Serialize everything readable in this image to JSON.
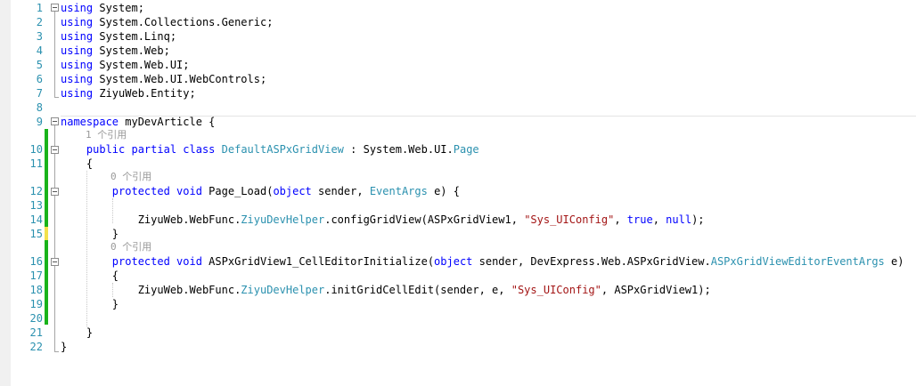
{
  "editor": {
    "line_numbers": [
      "1",
      "2",
      "3",
      "4",
      "5",
      "6",
      "7",
      "8",
      "9",
      "10",
      "11",
      "12",
      "13",
      "14",
      "15",
      "16",
      "17",
      "18",
      "19",
      "20",
      "21",
      "22"
    ],
    "lines": {
      "l1": [
        {
          "k": "kw",
          "t": "using"
        },
        {
          "k": "plain",
          "t": " System;"
        }
      ],
      "l2": [
        {
          "k": "kw",
          "t": "using"
        },
        {
          "k": "plain",
          "t": " System.Collections.Generic;"
        }
      ],
      "l3": [
        {
          "k": "kw",
          "t": "using"
        },
        {
          "k": "plain",
          "t": " System.Linq;"
        }
      ],
      "l4": [
        {
          "k": "kw",
          "t": "using"
        },
        {
          "k": "plain",
          "t": " System.Web;"
        }
      ],
      "l5": [
        {
          "k": "kw",
          "t": "using"
        },
        {
          "k": "plain",
          "t": " System.Web.UI;"
        }
      ],
      "l6": [
        {
          "k": "kw",
          "t": "using"
        },
        {
          "k": "plain",
          "t": " System.Web.UI.WebControls;"
        }
      ],
      "l7": [
        {
          "k": "kw",
          "t": "using"
        },
        {
          "k": "plain",
          "t": " ZiyuWeb.Entity;"
        }
      ],
      "l8": [],
      "l9": [
        {
          "k": "kw",
          "t": "namespace"
        },
        {
          "k": "plain",
          "t": " myDevArticle {"
        }
      ],
      "l10": [
        {
          "k": "plain",
          "t": "    "
        },
        {
          "k": "kw",
          "t": "public partial class"
        },
        {
          "k": "plain",
          "t": " "
        },
        {
          "k": "type",
          "t": "DefaultASPxGridView"
        },
        {
          "k": "plain",
          "t": " : System.Web.UI."
        },
        {
          "k": "type",
          "t": "Page"
        }
      ],
      "l11": [
        {
          "k": "plain",
          "t": "    {"
        }
      ],
      "l12": [
        {
          "k": "plain",
          "t": "        "
        },
        {
          "k": "kw",
          "t": "protected void"
        },
        {
          "k": "plain",
          "t": " Page_Load("
        },
        {
          "k": "kw",
          "t": "object"
        },
        {
          "k": "plain",
          "t": " sender, "
        },
        {
          "k": "type",
          "t": "EventArgs"
        },
        {
          "k": "plain",
          "t": " e) {"
        }
      ],
      "l13": [],
      "l14": [
        {
          "k": "plain",
          "t": "            ZiyuWeb.WebFunc."
        },
        {
          "k": "type",
          "t": "ZiyuDevHelper"
        },
        {
          "k": "plain",
          "t": ".configGridView(ASPxGridView1, "
        },
        {
          "k": "str",
          "t": "\"Sys_UIConfig\""
        },
        {
          "k": "plain",
          "t": ", "
        },
        {
          "k": "kw",
          "t": "true"
        },
        {
          "k": "plain",
          "t": ", "
        },
        {
          "k": "kw",
          "t": "null"
        },
        {
          "k": "plain",
          "t": ");"
        }
      ],
      "l15": [
        {
          "k": "plain",
          "t": "        }"
        }
      ],
      "l16": [
        {
          "k": "plain",
          "t": "        "
        },
        {
          "k": "kw",
          "t": "protected void"
        },
        {
          "k": "plain",
          "t": " ASPxGridView1_CellEditorInitialize("
        },
        {
          "k": "kw",
          "t": "object"
        },
        {
          "k": "plain",
          "t": " sender, DevExpress.Web.ASPxGridView."
        },
        {
          "k": "type",
          "t": "ASPxGridViewEditorEventArgs"
        },
        {
          "k": "plain",
          "t": " e)"
        }
      ],
      "l17": [
        {
          "k": "plain",
          "t": "        {"
        }
      ],
      "l18": [
        {
          "k": "plain",
          "t": "            ZiyuWeb.WebFunc."
        },
        {
          "k": "type",
          "t": "ZiyuDevHelper"
        },
        {
          "k": "plain",
          "t": ".initGridCellEdit(sender, e, "
        },
        {
          "k": "str",
          "t": "\"Sys_UIConfig\""
        },
        {
          "k": "plain",
          "t": ", ASPxGridView1);"
        }
      ],
      "l19": [
        {
          "k": "plain",
          "t": "        }"
        }
      ],
      "l20": [],
      "l21": [
        {
          "k": "plain",
          "t": "    }"
        }
      ],
      "l22": [
        {
          "k": "plain",
          "t": "}"
        }
      ]
    },
    "codelens": {
      "class_refs": "1 个引用",
      "page_load_refs": "0 个引用",
      "cell_editor_refs": "0 个引用"
    },
    "colors": {
      "keyword": "#0000ff",
      "type": "#2b91af",
      "string": "#a31515",
      "line_number": "#2b91af",
      "changed_saved": "#19b31a",
      "changed_unsaved": "#f2e14c"
    }
  }
}
